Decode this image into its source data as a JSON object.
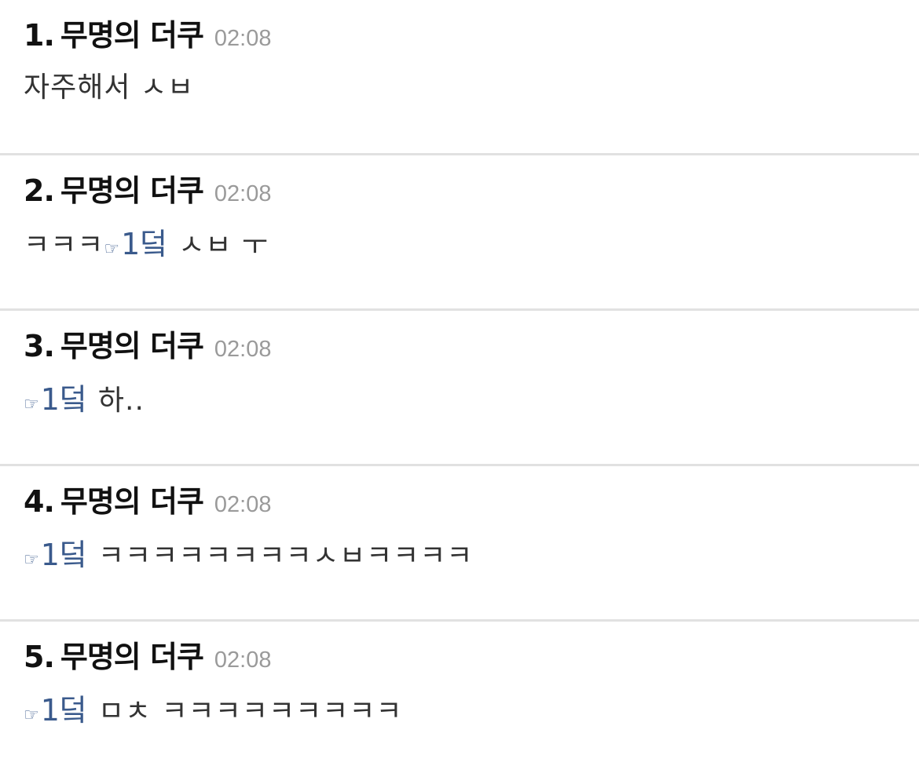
{
  "colors": {
    "author": "#111111",
    "timestamp": "#9a9a9a",
    "body": "#333333",
    "anchor": "#3a5a8c",
    "divider": "#e1e1e1"
  },
  "comments": [
    {
      "number": "1.",
      "author": "무명의 더쿠",
      "time": "02:08",
      "prefix": "",
      "anchor": "",
      "text": "자주해서 ㅅㅂ"
    },
    {
      "number": "2.",
      "author": "무명의 더쿠",
      "time": "02:08",
      "prefix": "ㅋㅋㅋ",
      "anchor": "1덬",
      "text": "ㅅㅂ ㅜ"
    },
    {
      "number": "3.",
      "author": "무명의 더쿠",
      "time": "02:08",
      "prefix": "",
      "anchor": "1덬",
      "text": "하.."
    },
    {
      "number": "4.",
      "author": "무명의 더쿠",
      "time": "02:08",
      "prefix": "",
      "anchor": "1덬",
      "text": "ㅋㅋㅋㅋㅋㅋㅋㅋㅅㅂㅋㅋㅋㅋ"
    },
    {
      "number": "5.",
      "author": "무명의 더쿠",
      "time": "02:08",
      "prefix": "",
      "anchor": "1덬",
      "text": "ㅁㅊ ㅋㅋㅋㅋㅋㅋㅋㅋㅋ"
    }
  ]
}
